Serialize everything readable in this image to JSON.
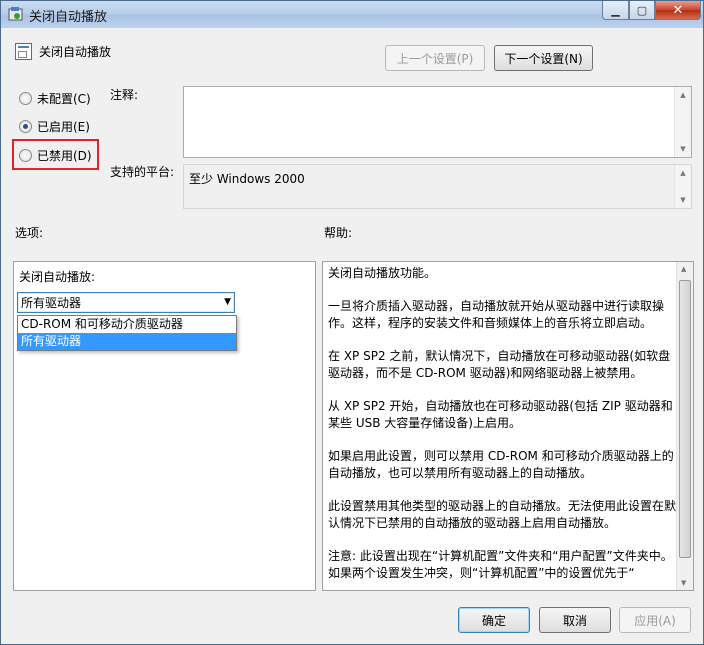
{
  "window": {
    "title": "关闭自动播放"
  },
  "header": {
    "policy_name": "关闭自动播放",
    "prev_button": "上一个设置(P)",
    "next_button": "下一个设置(N)"
  },
  "state": {
    "options": [
      {
        "label": "未配置(C)",
        "checked": false
      },
      {
        "label": "已启用(E)",
        "checked": true
      },
      {
        "label": "已禁用(D)",
        "checked": false
      }
    ]
  },
  "comment": {
    "label": "注释:",
    "value": ""
  },
  "platform": {
    "label": "支持的平台:",
    "value": "至少 Windows 2000"
  },
  "options_section": {
    "label": "选项:",
    "field_label": "关闭自动播放:",
    "selected": "所有驱动器",
    "dropdown_items": [
      "CD-ROM 和可移动介质驱动器",
      "所有驱动器"
    ],
    "highlighted_index": 1
  },
  "help_section": {
    "label": "帮助:",
    "paragraphs": [
      "关闭自动播放功能。",
      "一旦将介质插入驱动器，自动播放就开始从驱动器中进行读取操作。这样，程序的安装文件和音频媒体上的音乐将立即启动。",
      "在 XP SP2 之前，默认情况下，自动播放在可移动驱动器(如软盘驱动器，而不是 CD-ROM 驱动器)和网络驱动器上被禁用。",
      "从 XP SP2 开始，自动播放也在可移动驱动器(包括 ZIP 驱动器和某些 USB 大容量存储设备)上启用。",
      "如果启用此设置，则可以禁用 CD-ROM 和可移动介质驱动器上的自动播放，也可以禁用所有驱动器上的自动播放。",
      "此设置禁用其他类型的驱动器上的自动播放。无法使用此设置在默认情况下已禁用的自动播放的驱动器上启用自动播放。",
      "注意: 此设置出现在“计算机配置”文件夹和“用户配置”文件夹中。如果两个设置发生冲突，则“计算机配置”中的设置优先于“"
    ]
  },
  "footer": {
    "ok": "确定",
    "cancel": "取消",
    "apply": "应用(A)"
  },
  "colors": {
    "highlight_box": "#e0232a",
    "selection": "#3399ff"
  }
}
